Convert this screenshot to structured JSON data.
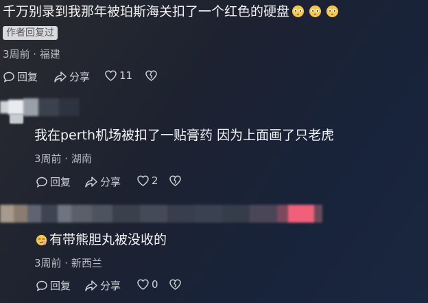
{
  "comment1": {
    "text": "千万别录到我那年被珀斯海关扣了一个红色的硬盘",
    "emojis": [
      "flushed-face-icon",
      "flushed-face-icon",
      "flushed-face-icon"
    ],
    "badge": "作者回复过",
    "meta": "3周前 · 福建",
    "reply_label": "回复",
    "share_label": "分享",
    "like_count": "11"
  },
  "reply1": {
    "text": "我在perth机场被扣了一贴膏药 因为上面画了只老虎",
    "meta": "3周前 · 湖南",
    "reply_label": "回复",
    "share_label": "分享",
    "like_count": "2"
  },
  "reply2": {
    "emoji": "smirking-face-icon",
    "text": "有带熊胆丸被没收的",
    "meta": "3周前 · 新西兰",
    "reply_label": "回复",
    "share_label": "分享",
    "like_count": "0"
  },
  "colors": {
    "accent_pink": "#f0607a",
    "text": "#f2f2f2",
    "meta": "#b9bcc4"
  }
}
